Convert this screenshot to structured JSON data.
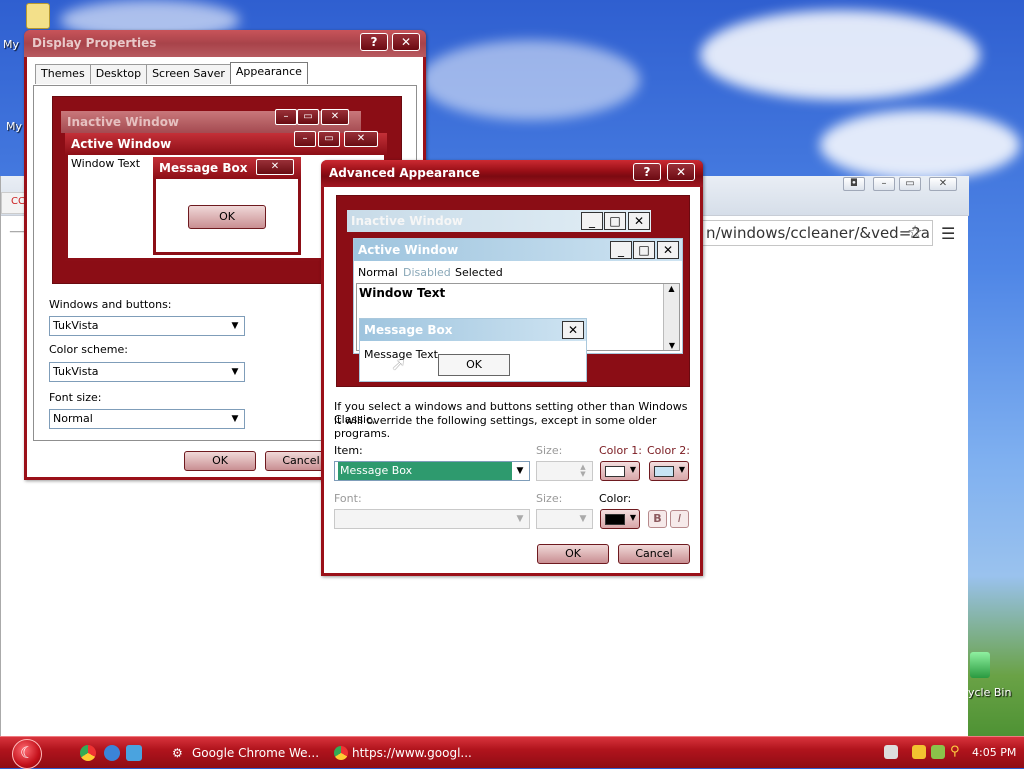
{
  "desktop": {
    "icons": [
      {
        "label": "My"
      },
      {
        "label": "My"
      },
      {
        "label": "ycle Bin"
      }
    ]
  },
  "chrome": {
    "omnibox_text": "n/windows/ccleaner/&ved=2a",
    "tab_fragment": "CC"
  },
  "display_properties": {
    "title": "Display Properties",
    "help_btn": "?",
    "close_btn": "✕",
    "tabs": [
      "Themes",
      "Desktop",
      "Screen Saver",
      "Appearance"
    ],
    "active_tab": "Appearance",
    "preview": {
      "inactive_title": "Inactive Window",
      "active_title": "Active Window",
      "window_text": "Window Text",
      "msgbox_title": "Message Box",
      "ok_label": "OK"
    },
    "windows_buttons_label": "Windows and buttons:",
    "windows_buttons_value": "TukVista",
    "color_scheme_label": "Color scheme:",
    "color_scheme_value": "TukVista",
    "font_size_label": "Font size:",
    "font_size_value": "Normal",
    "ok_label": "OK",
    "cancel_label": "Cancel"
  },
  "advanced_appearance": {
    "title": "Advanced Appearance",
    "help_btn": "?",
    "close_btn": "✕",
    "preview": {
      "inactive_title": "Inactive Window",
      "active_title": "Active Window",
      "menu_normal": "Normal",
      "menu_disabled": "Disabled",
      "menu_selected": "Selected",
      "window_text": "Window Text",
      "msgbox_title": "Message Box",
      "msgbox_text": "Message Text",
      "ok_label": "OK"
    },
    "info_text_line1": "If you select a windows and buttons setting other than Windows Classic,",
    "info_text_line2": "it will override the following settings, except in some older programs.",
    "item_label": "Item:",
    "item_value": "Message Box",
    "size_label": "Size:",
    "color1_label": "Color 1:",
    "color2_label": "Color 2:",
    "font_label": "Font:",
    "size2_label": "Size:",
    "color_label": "Color:",
    "bold_label": "B",
    "italic_label": "I",
    "ok_label": "OK",
    "cancel_label": "Cancel",
    "colors": {
      "color1": "#ffffff",
      "color2": "#c8e4f4",
      "font_color": "#000000",
      "item_highlight": "#2e9a6e"
    }
  },
  "taskbar": {
    "tasks": [
      "Google Chrome We...",
      "https://www.googl..."
    ],
    "clock": "4:05 PM"
  }
}
